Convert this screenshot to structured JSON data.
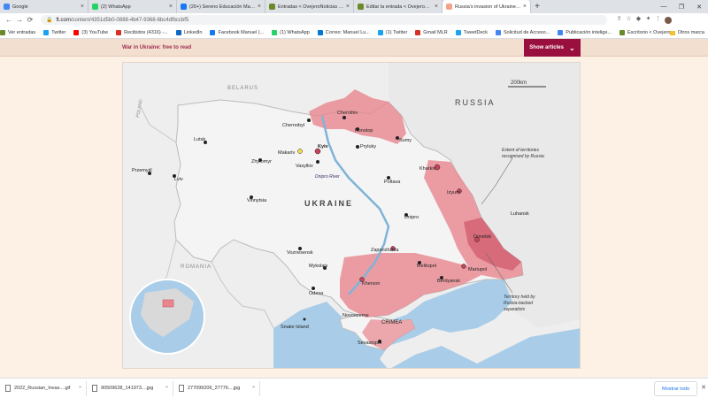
{
  "tabs": [
    {
      "label": "Google",
      "color": "#4285f4",
      "active": false
    },
    {
      "label": "(2) WhatsApp",
      "color": "#25d366",
      "active": false
    },
    {
      "label": "(20+) Sereno Educación Magallan",
      "color": "#1877f2",
      "active": false
    },
    {
      "label": "Entradas < OvejeroNoticias — W",
      "color": "#6a8a2a",
      "active": false
    },
    {
      "label": "Editar la entrada < OvejeroNoticia",
      "color": "#6a8a2a",
      "active": false
    },
    {
      "label": "Russia's invasion of Ukraine in m",
      "color": "#f2a38a",
      "active": true
    }
  ],
  "toolbar": {
    "back": "←",
    "forward": "→",
    "reload": "⟳",
    "url_host": "ft.com",
    "url_path": "/content/4351d5b0-0888-4b47-9368-6bc4dfbccbf5"
  },
  "bookmarks": [
    {
      "label": "Ver entradas",
      "color": "#6a8a2a"
    },
    {
      "label": "Twitter",
      "color": "#1da1f2"
    },
    {
      "label": "(3) YouTube",
      "color": "#ff0000"
    },
    {
      "label": "Recibidos (4316) -...",
      "color": "#d93025"
    },
    {
      "label": "LinkedIn",
      "color": "#0a66c2"
    },
    {
      "label": "Facebook Manuel (...",
      "color": "#1877f2"
    },
    {
      "label": "(1) WhatsApp",
      "color": "#25d366"
    },
    {
      "label": "Correo: Manuel Lu...",
      "color": "#0078d4"
    },
    {
      "label": "(1) Twitter",
      "color": "#1da1f2"
    },
    {
      "label": "Gmail MLR",
      "color": "#d93025"
    },
    {
      "label": "TweetDeck",
      "color": "#1da1f2"
    },
    {
      "label": "Solicitud de Acceso...",
      "color": "#4285f4"
    },
    {
      "label": "Publicación intelige...",
      "color": "#4285f4"
    },
    {
      "label": "Escritorio < Ovejero...",
      "color": "#6a8a2a"
    }
  ],
  "bookmarks_other": "Otros marca",
  "ft": {
    "war_title": "War in Ukraine: free to read",
    "show_articles": "Show articles",
    "accent": "#990f3d"
  },
  "map": {
    "scale": "200km",
    "countries": {
      "russia": "RUSSIA",
      "ukraine": "UKRAINE",
      "belarus": "BELARUS",
      "poland": "POLAND",
      "romania": "ROMANIA"
    },
    "annotations": {
      "recognised_1": "Extent of territories",
      "recognised_2": "recognised by Russia",
      "held_1": "Territory held by",
      "held_2": "Russia-backed",
      "held_3": "separatists"
    },
    "cities": {
      "chernobyl": "Chernobyl",
      "chernihiv": "Chernihiv",
      "konotop": "Konotop",
      "sumy": "Sumy",
      "pryluky": "Pryluky",
      "lutsk": "Lutsk",
      "makariv": "Makariv",
      "kyiv": "Kyiv",
      "vasylkiv": "Vasylkiv",
      "zhytomyr": "Zhytomyr",
      "kharkiv": "Kharkiv",
      "przemysl": "Przemyśl",
      "lviv": "Lviv",
      "dnipro_river": "Dnipro River",
      "poltava": "Poltava",
      "izyum": "Izyum",
      "luhansk": "Luhansk",
      "vinnytsia": "Vinnytsia",
      "dnipro": "Dnipro",
      "donetsk": "Donetsk",
      "voznesensk": "Voznesensk",
      "zaporizhzhia": "Zaporizhzhia",
      "mykolaiv": "Mykolaiv",
      "melitopol": "Melitopol",
      "mariupol": "Mariupol",
      "kherson": "Kherson",
      "berdyansk": "Berdyansk",
      "odesa": "Odesa",
      "novoozerne": "Novoozerne",
      "crimea": "CRIMEA",
      "snake_island": "Snake Island",
      "sevastopol": "Sevastopol"
    },
    "colors": {
      "held": "#e8868e",
      "held_dark": "#c9435a",
      "land": "#f2f2f2",
      "sea": "#a9cde8"
    }
  },
  "downloads": [
    {
      "label": "2022_Russian_Invas....gif"
    },
    {
      "label": "90509628_141973....jpg"
    },
    {
      "label": "277099206_27776....jpg"
    }
  ],
  "downloads_show_all": "Mostrar todo",
  "downloads_close": "✕"
}
